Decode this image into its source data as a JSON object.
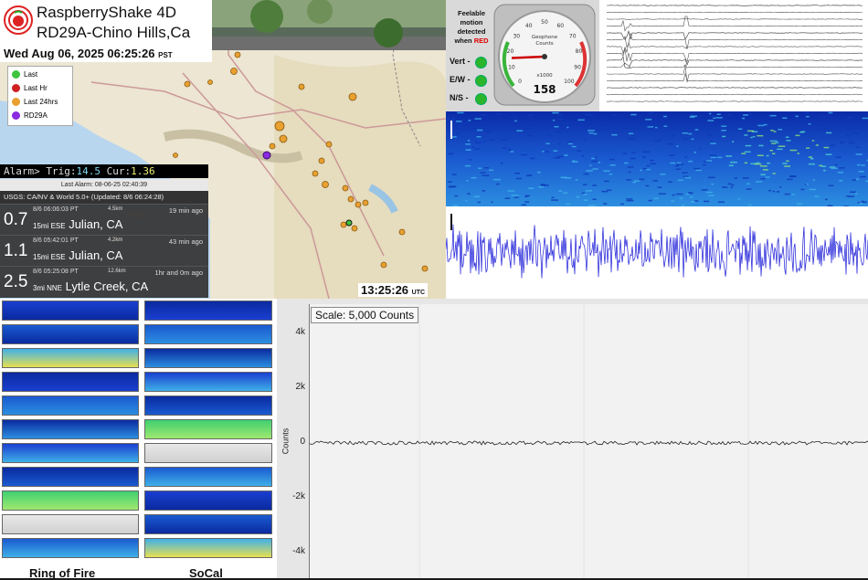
{
  "header": {
    "brand_line1": "RaspberryShake 4D",
    "brand_line2": "RD29A-Chino Hills,Ca",
    "datetime": "Wed Aug 06, 2025 06:25:26",
    "datetime_tz": "PST"
  },
  "legend": {
    "items": [
      {
        "label": "Last",
        "color": "#3ec43e"
      },
      {
        "label": "Last Hr",
        "color": "#d02020"
      },
      {
        "label": "Last 24hrs",
        "color": "#e8a030"
      },
      {
        "label": "RD29A",
        "color": "#8a2be2"
      }
    ]
  },
  "alarm": {
    "prefix": "Alarm> Trig:",
    "trig": "14.5",
    "cur_label": "Cur:",
    "cur": "1.36",
    "last_alarm": "Last Alarm: 08-06-25 02:40:39"
  },
  "usgs": {
    "heading": "USGS: CA/NV & World 5.0+ (Updated: 8/6 06:24:28)",
    "quakes": [
      {
        "mag": "0.7",
        "time": "8/6 06:06:03 PT",
        "depth": "4.5km",
        "ago": "19 min ago",
        "loc_small": "15mi ESE",
        "loc": "Julian, CA"
      },
      {
        "mag": "1.1",
        "time": "8/6 05:42:01 PT",
        "depth": "4.2km",
        "ago": "43 min ago",
        "loc_small": "15mi ESE",
        "loc": "Julian, CA"
      },
      {
        "mag": "2.5",
        "time": "8/6 05:25:08 PT",
        "depth": "12.6km",
        "ago": "1hr and 0m ago",
        "loc_small": "3mi NNE",
        "loc": "Lytle Creek, CA"
      }
    ]
  },
  "clock": {
    "time": "13:25:26",
    "tz": "UTC"
  },
  "motion": {
    "line1": "Feelable",
    "line2": "motion",
    "line3": "detected",
    "line4_pre": "when",
    "line4_red": "RED",
    "axes": [
      "Vert -",
      "E/W -",
      "N/S -"
    ]
  },
  "gauge": {
    "label_top": "Geophone",
    "label_sub": "Counts",
    "mult": "x1000",
    "value": "158",
    "needle_value": 158,
    "scale": [
      "0",
      "10",
      "20",
      "30",
      "40",
      "50",
      "60",
      "70",
      "80",
      "90",
      "100"
    ]
  },
  "grid": {
    "left_title": "Ring of Fire",
    "right_title": "SoCal"
  },
  "plot": {
    "scale_label": "Scale: 5,000 Counts",
    "yticks": [
      "4k",
      "2k",
      "0",
      "-2k",
      "-4k"
    ],
    "ylabel": "Counts"
  }
}
